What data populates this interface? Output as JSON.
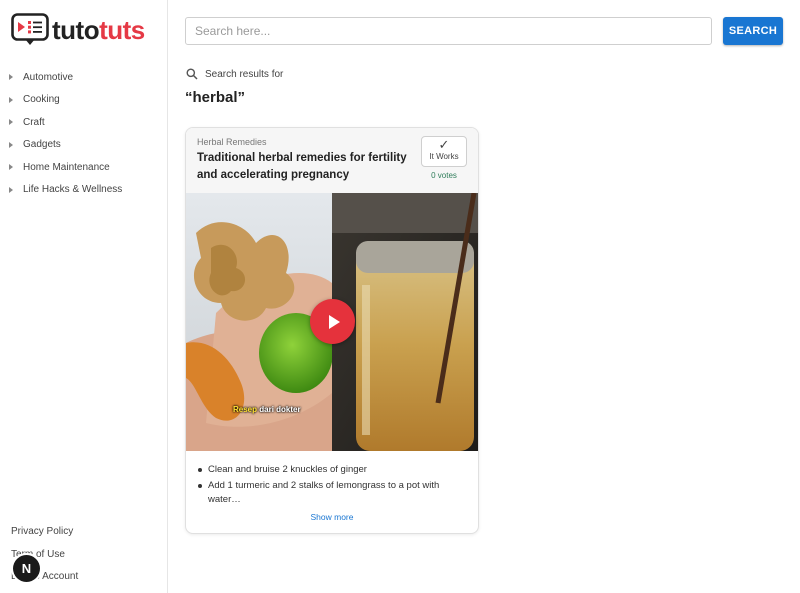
{
  "brand": {
    "name_part1": "tuto",
    "name_part2": "tuts",
    "accent": "#e53945"
  },
  "sidebar": {
    "categories": [
      {
        "label": "Automotive"
      },
      {
        "label": "Cooking"
      },
      {
        "label": "Craft"
      },
      {
        "label": "Gadgets"
      },
      {
        "label": "Home Maintenance"
      },
      {
        "label": "Life Hacks & Wellness"
      }
    ],
    "footer_links": [
      {
        "label": "Privacy Policy"
      },
      {
        "label": "Term of Use"
      },
      {
        "label": "Delete Account"
      }
    ],
    "badge_letter": "N"
  },
  "search": {
    "placeholder": "Search here...",
    "value": "",
    "button_label": "SEARCH",
    "button_color": "#1976d2"
  },
  "results": {
    "label": "Search results for",
    "query": "“herbal”"
  },
  "card": {
    "category": "Herbal Remedies",
    "title": "Traditional herbal remedies for fertility and accelerating pregnancy",
    "it_works_icon": "✓",
    "it_works_label": "It Works",
    "votes": "0 votes",
    "media_caption_highlight": "Resep",
    "media_caption_rest": " dari dokter",
    "steps": [
      "Clean and bruise 2 knuckles of ginger",
      "Add 1 turmeric and 2 stalks of lemongrass to a pot with water…"
    ],
    "show_more": "Show more"
  }
}
